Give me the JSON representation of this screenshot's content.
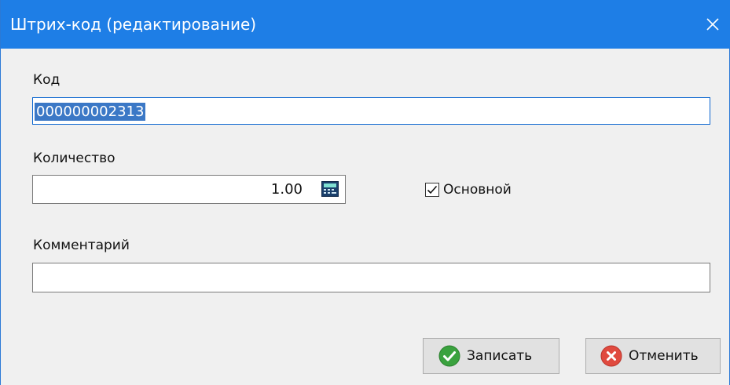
{
  "window": {
    "title": "Штрих-код (редактирование)",
    "titlebar_color": "#1e7ee6"
  },
  "fields": {
    "code": {
      "label": "Код",
      "value": "000000002313",
      "selected": true
    },
    "quantity": {
      "label": "Количество",
      "value": "1.00",
      "icon": "calculator-icon"
    },
    "main_checkbox": {
      "label": "Основной",
      "checked": true
    },
    "comment": {
      "label": "Комментарий",
      "value": ""
    }
  },
  "buttons": {
    "save": {
      "label": "Записать",
      "icon": "check-circle-icon",
      "icon_color": "#3aa23e"
    },
    "cancel": {
      "label": "Отменить",
      "icon": "x-circle-icon",
      "icon_color": "#e04a3f"
    }
  }
}
